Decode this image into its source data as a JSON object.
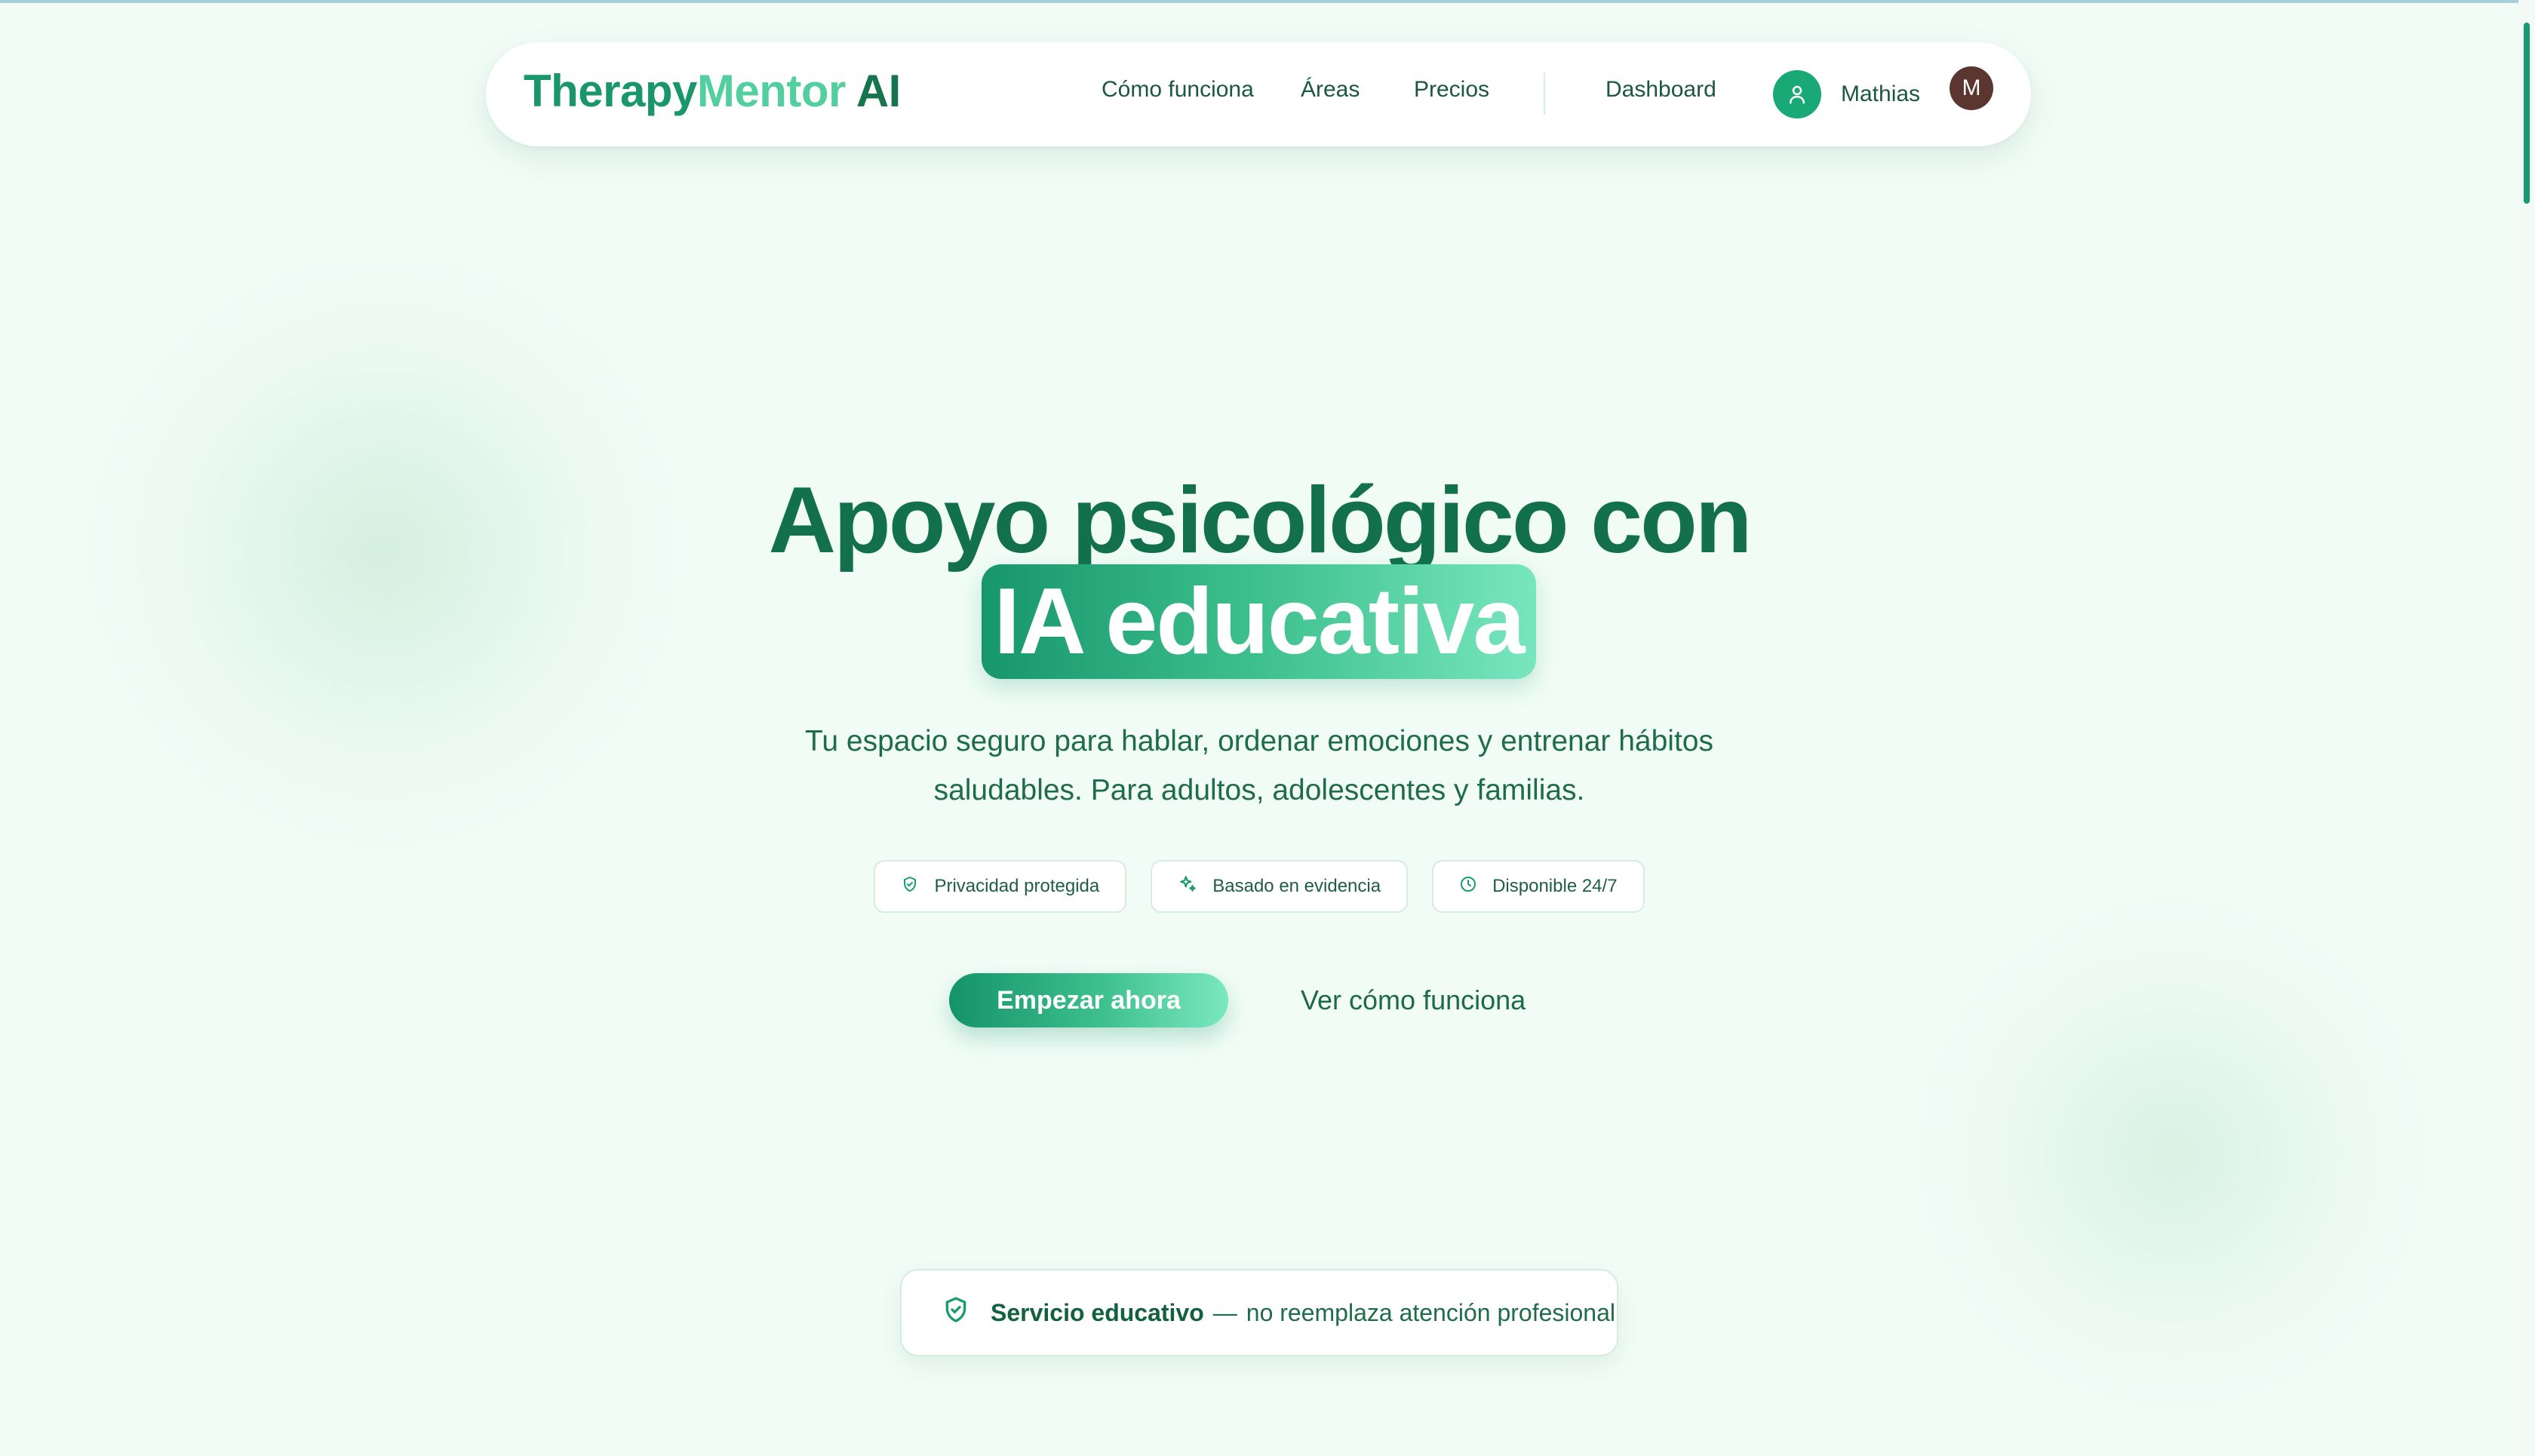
{
  "brand": {
    "part1": "Therapy",
    "part2": "Mentor",
    "part3": " AI"
  },
  "nav": {
    "links": [
      "Cómo funciona",
      "Áreas",
      "Precios"
    ],
    "dashboard": "Dashboard",
    "user_name": "Mathias",
    "avatar_initial": "M"
  },
  "hero": {
    "title_line1": "Apoyo psicológico con",
    "title_line2": "IA educativa",
    "subtitle": "Tu espacio seguro para hablar, ordenar emociones y entrenar hábitos saludables. Para adultos, adolescentes y familias."
  },
  "badges": [
    {
      "icon": "shield-icon",
      "label": "Privacidad protegida"
    },
    {
      "icon": "sparkles-icon",
      "label": "Basado en evidencia"
    },
    {
      "icon": "clock-icon",
      "label": "Disponible 24/7"
    }
  ],
  "actions": {
    "primary": "Empezar ahora",
    "secondary": "Ver cómo funciona"
  },
  "notice": {
    "strong": "Servicio educativo",
    "dash": "—",
    "rest": "no reemplaza atención profesional"
  },
  "colors": {
    "brand": "#19966a",
    "accent_light": "#78e6bf",
    "text_dark": "#12714c",
    "background": "#f1fcf7"
  }
}
